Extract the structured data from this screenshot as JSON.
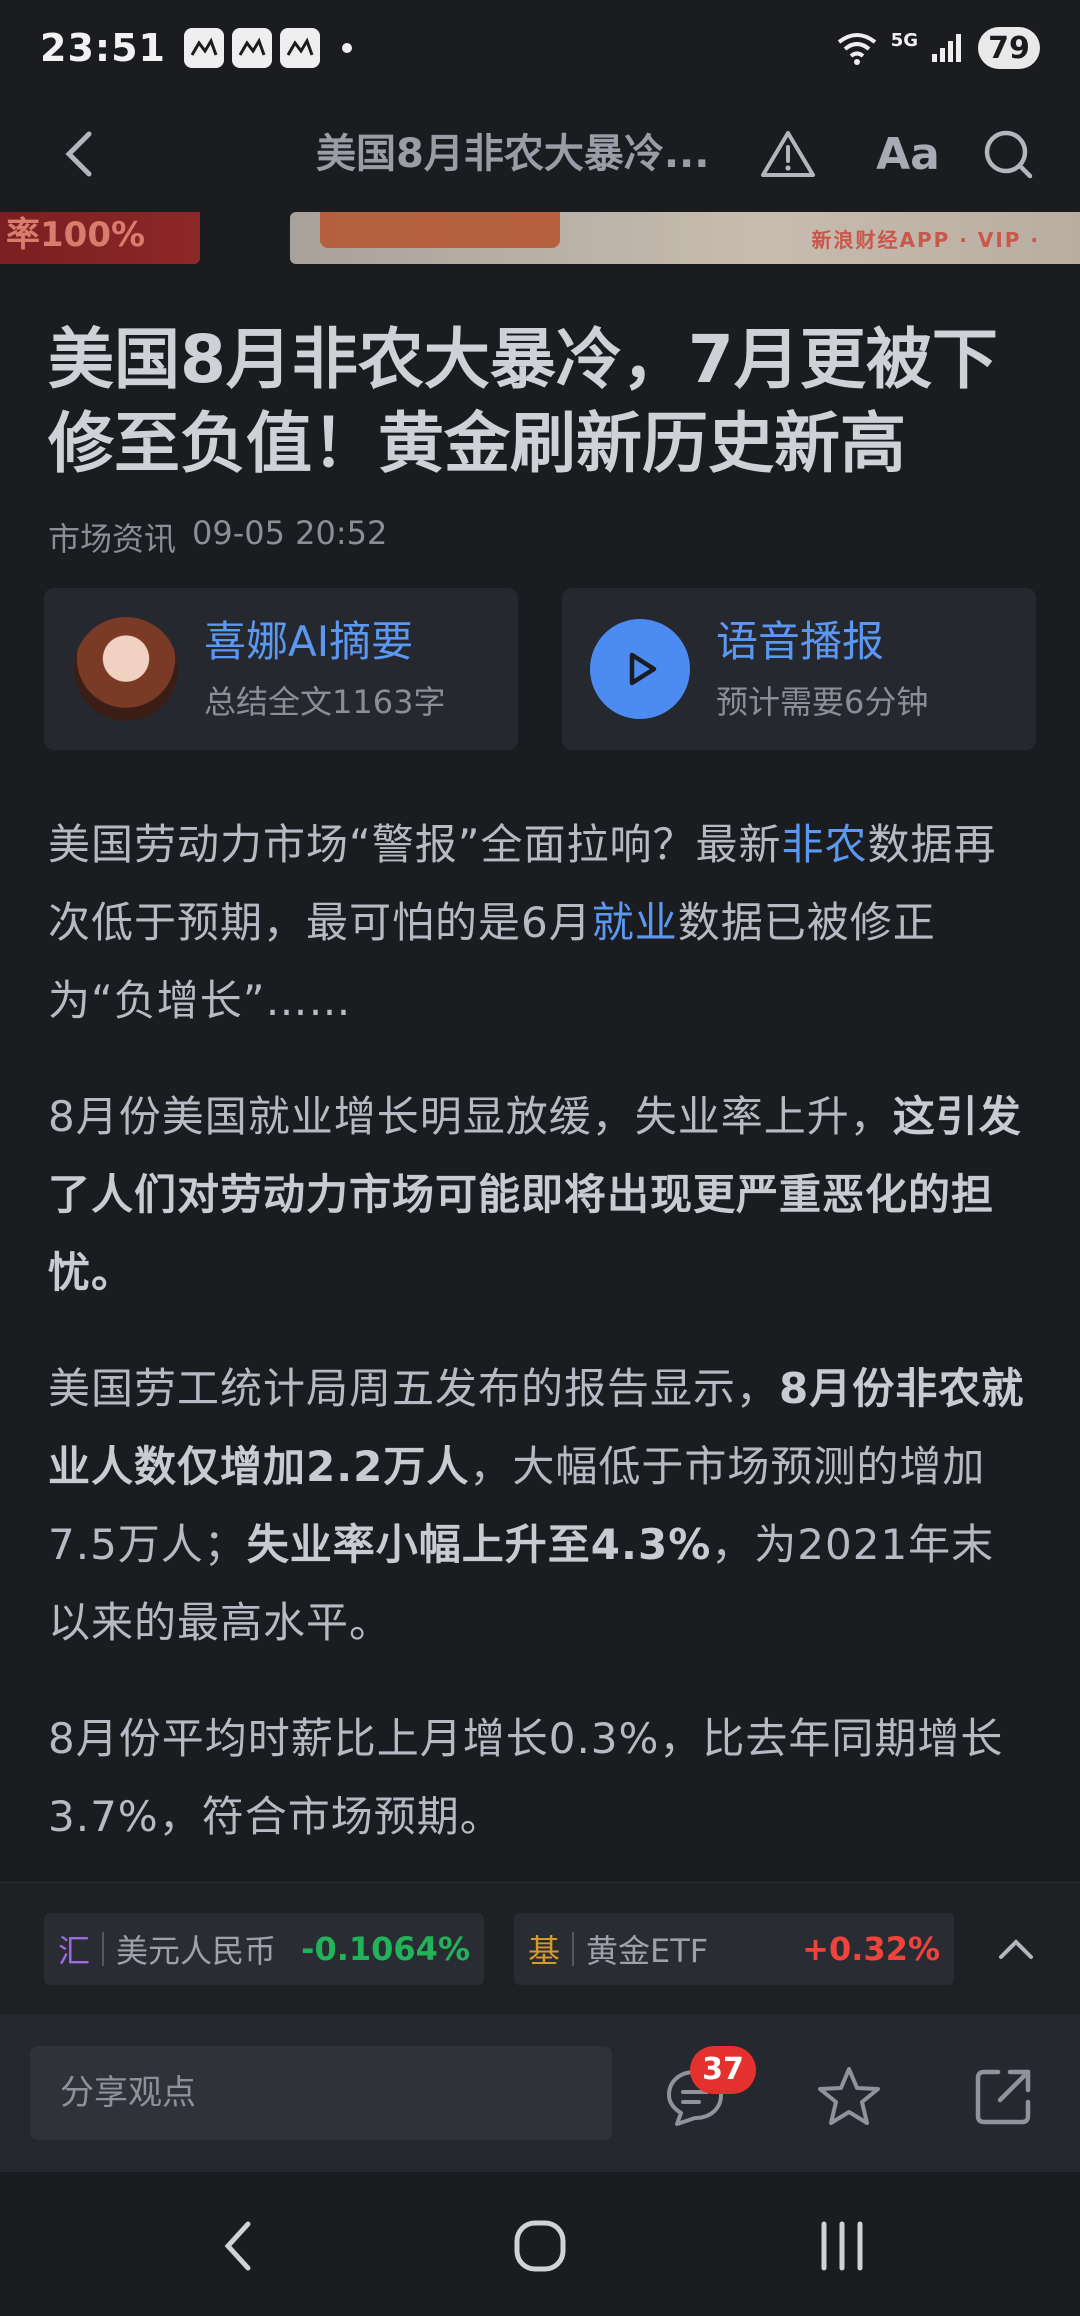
{
  "status_bar": {
    "time": "23:51",
    "network": "5G",
    "battery": "79"
  },
  "header": {
    "title": "美国8月非农大暴冷...",
    "font_button": "Aa"
  },
  "banner": {
    "left_text": "率100%",
    "right_text": "新浪财经APP · VIP ·"
  },
  "article": {
    "title": "美国8月非农大暴冷，7月更被下修至负值！黄金刷新历史新高",
    "source": "市场资讯",
    "datetime": "09-05 20:52"
  },
  "cards": {
    "ai_summary": {
      "title": "喜娜AI摘要",
      "subtitle": "总结全文1163字"
    },
    "audio": {
      "title": "语音播报",
      "subtitle": "预计需要6分钟"
    }
  },
  "body": {
    "p1": {
      "a": "美国劳动力市场“警报”全面拉响？最新",
      "link1": "非农",
      "b": "数据再次低于预期，最可怕的是6月",
      "link2": "就业",
      "c": "数据已被修正为“负增长”……"
    },
    "p2": {
      "a": "8月份美国就业增长明显放缓，失业率上升，",
      "bold": "这引发了人们对劳动力市场可能即将出现更严重恶化的担忧。"
    },
    "p3": {
      "a": "美国劳工统计局周五发布的报告显示，",
      "bold1": "8月份非农就业人数仅增加2.2万人",
      "b": "，大幅低于市场预测的增加7.5万人；",
      "bold2": "失业率小幅上升至4.3%",
      "c": "，为2021年末以来的最高水平。"
    },
    "p4": "8月份平均时薪比上月增长0.3%，比去年同期增长3.7%，符合市场预期。"
  },
  "tickers": [
    {
      "tag": "汇",
      "name": "美元人民币",
      "change": "-0.1064%",
      "tag_color": "#9b6ae0",
      "change_color": "#22b35a"
    },
    {
      "tag": "基",
      "name": "黄金ETF",
      "change": "+0.32%",
      "tag_color": "#d59a2a",
      "change_color": "#f0443a"
    }
  ],
  "action_bar": {
    "comment_placeholder": "分享观点",
    "comment_count": "37"
  },
  "colors": {
    "accent": "#5a98f2",
    "background": "#1b1c20",
    "badge": "#e5312e"
  }
}
